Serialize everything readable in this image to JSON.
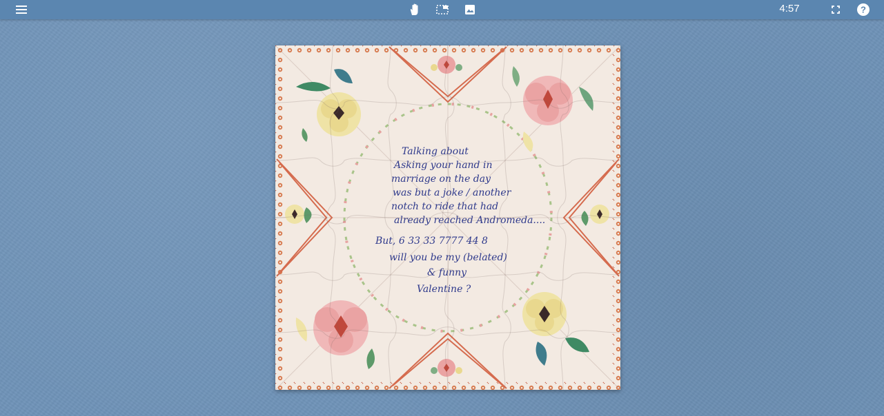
{
  "toolbar": {
    "menu_icon": "hamburger-menu-icon",
    "tools": [
      {
        "name": "move-tool-button",
        "icon": "hand-icon"
      },
      {
        "name": "edge-pieces-button",
        "icon": "dashed-frame-icon"
      },
      {
        "name": "preview-image-button",
        "icon": "image-icon"
      }
    ],
    "timer": "4:57",
    "fullscreen_icon": "fullscreen-icon",
    "help_icon": "help-icon"
  },
  "puzzle": {
    "grid_rows": 6,
    "grid_cols": 6,
    "card_colors": {
      "background": "#f3eae2",
      "border_trim": "#d77a4f",
      "diagonal_lines": "#d56b4e",
      "ink": "#2f3a8c"
    },
    "message_lines": [
      "Talking about",
      "Asking your hand in",
      "marriage on the day",
      "was but a joke / another",
      "notch to ride that had",
      "already reached Andromeda....",
      "But, 6 33 33 7777 44 8",
      "will you be my (belated)",
      "& funny",
      "Valentine ?"
    ]
  },
  "colors": {
    "background": "#6f93b8",
    "topbar": "#5b86b0",
    "icon": "#ffffff"
  }
}
